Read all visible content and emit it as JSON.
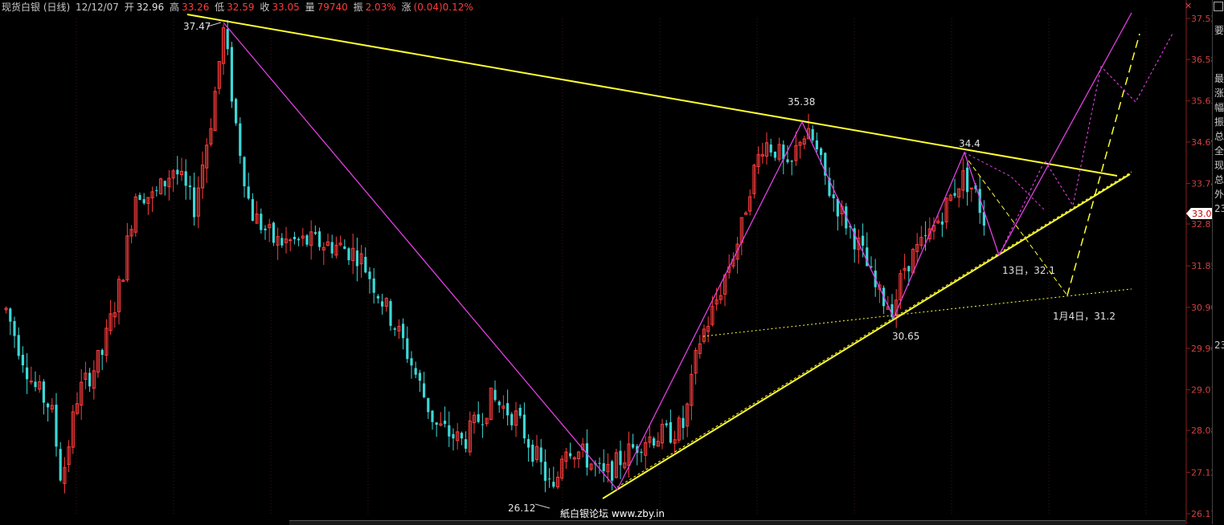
{
  "header": {
    "title": "现货白银 (日线)",
    "date": "12/12/07",
    "open_label": "开",
    "open": "32.96",
    "high_label": "高",
    "high": "33.26",
    "low_label": "低",
    "low": "32.59",
    "close_label": "收",
    "close": "33.05",
    "volume_label": "量",
    "volume": "79740",
    "amplitude_label": "振",
    "amplitude": "2.03%",
    "change_label": "涨",
    "change": "(0.04)0.12%"
  },
  "chart_data": {
    "type": "candlestick",
    "y_ticks": [
      "37.52",
      "36.58",
      "35.63",
      "34.69",
      "33.74",
      "32.81",
      "31.85",
      "30.90",
      "29.96",
      "29.01",
      "28.08",
      "27.12",
      "26.17"
    ],
    "ylim": [
      26.17,
      37.52
    ],
    "current_price": "33.05",
    "annotations": {
      "high_1": "37.47",
      "low_1": "26.12",
      "high_2": "35.38",
      "high_3": "34.4",
      "low_2": "30.65",
      "target_1": "13日，32.1",
      "target_2": "1月4日，31.2"
    },
    "watermark": "紙白银论坛 www.zby.in",
    "colors": {
      "up": "#ff3c3c",
      "down": "#3cd8d8",
      "trendline": "#ffff33",
      "wave": "#e040e0"
    }
  },
  "sidebar": {
    "chars": [
      "要",
      "最",
      "涨",
      "幅",
      "振",
      "总",
      "全",
      "现",
      "总",
      "外",
      "23",
      "23"
    ]
  },
  "icons": {
    "top": "close-icon"
  }
}
